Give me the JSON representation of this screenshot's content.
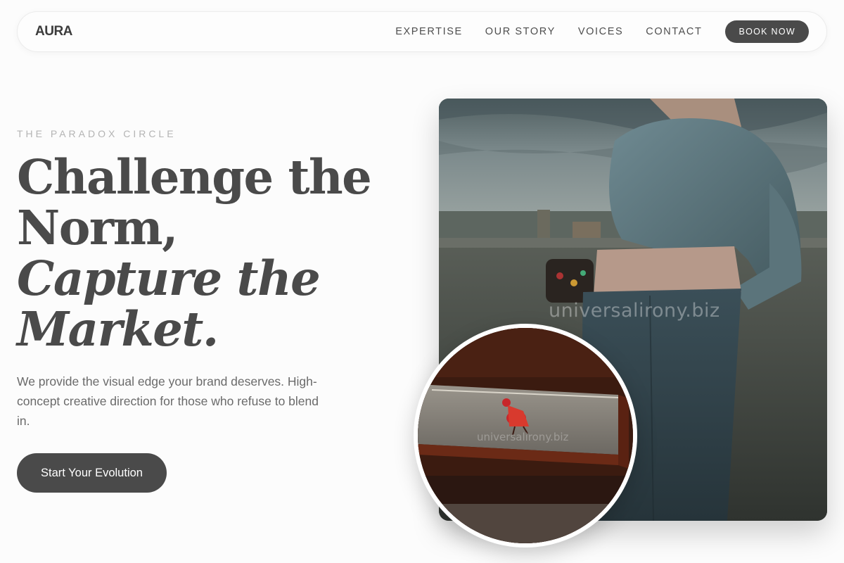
{
  "brand": {
    "logo": "AURA"
  },
  "nav": {
    "links": [
      "EXPERTISE",
      "OUR STORY",
      "VOICES",
      "CONTACT"
    ],
    "cta_label": "BOOK NOW"
  },
  "hero": {
    "eyebrow": "THE PARADOX CIRCLE",
    "headline": {
      "line1": "Challenge the",
      "line2": "Norm,",
      "line3": "Capture the",
      "line4": "Market."
    },
    "subcopy": "We provide the visual edge your brand deserves. High-concept creative direction for those who refuse to blend in.",
    "cta_label": "Start Your Evolution"
  },
  "images": {
    "main_watermark": "universalirony.biz",
    "circle_watermark": "universalirony.biz"
  },
  "colors": {
    "accent_dark": "#4a4a4a",
    "background": "#fcfcfc",
    "eyebrow": "#b4b4b4"
  }
}
